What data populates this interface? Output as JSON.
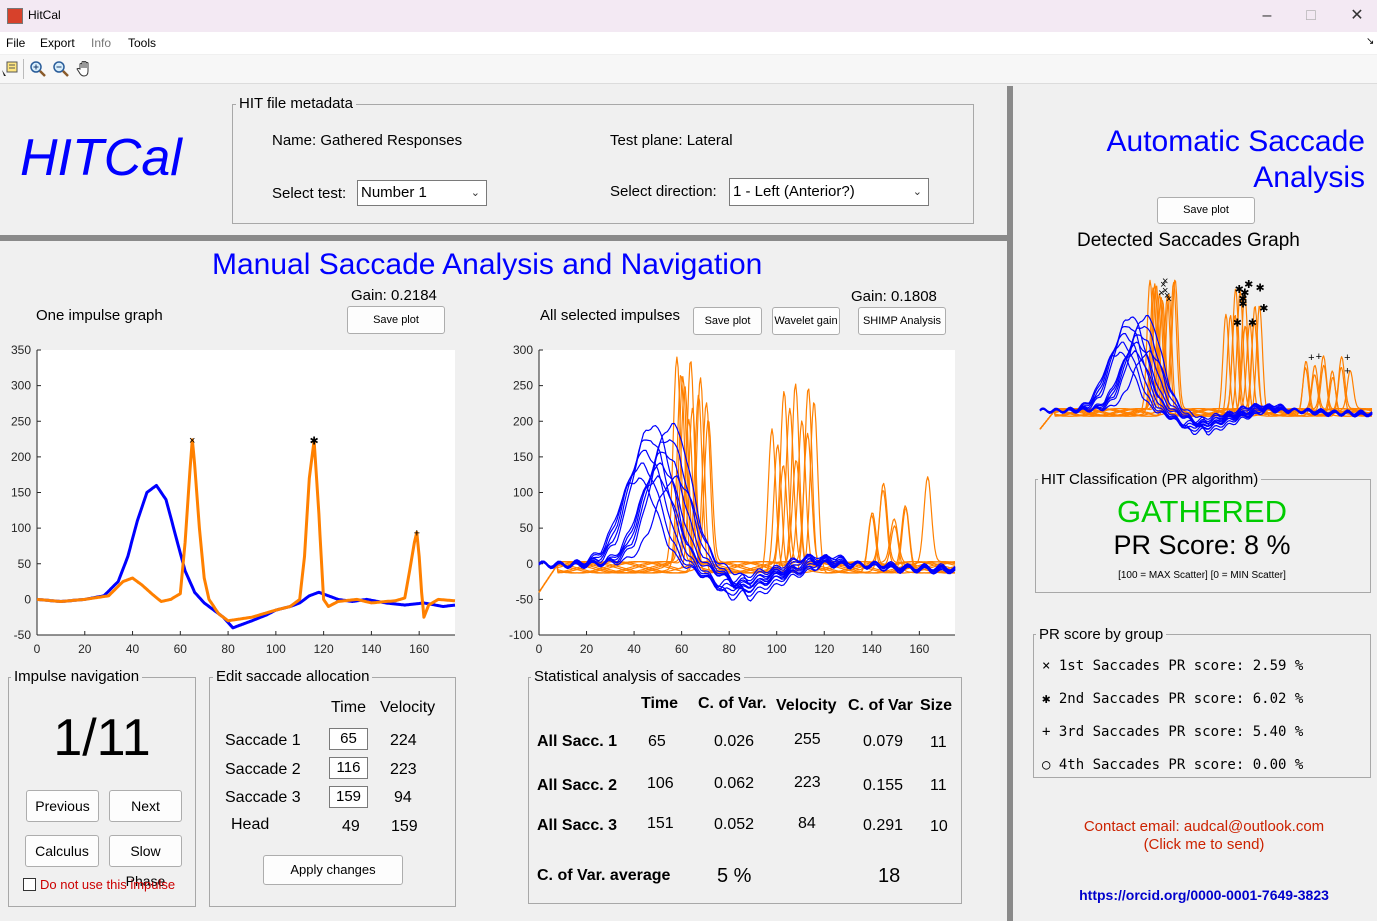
{
  "window": {
    "title": "HitCal",
    "minimize": "–",
    "maximize": "□",
    "close": "✕"
  },
  "menu": [
    "File",
    "Export",
    "Info",
    "Tools"
  ],
  "toolbar": {
    "icons": [
      "data-cursor-icon",
      "zoom-in-icon",
      "zoom-out-icon",
      "pan-hand-icon"
    ]
  },
  "logo": "HITCal",
  "metadata": {
    "legend": "HIT file metadata",
    "name": "Name: Gathered Responses",
    "plane": "Test plane: Lateral",
    "select_test_label": "Select test:",
    "select_test_value": "Number 1",
    "select_direction_label": "Select direction:",
    "select_direction_value": "1 - Left (Anterior?)"
  },
  "manual": {
    "title": "Manual Saccade Analysis and Navigation",
    "one_impulse": {
      "label": "One impulse graph",
      "gain": "Gain: 0.2184",
      "save": "Save plot"
    },
    "all_impulses": {
      "label": "All selected impulses",
      "gain": "Gain: 0.1808",
      "save": "Save plot",
      "wavelet": "Wavelet gain",
      "shimp": "SHIMP Analysis"
    }
  },
  "navigation": {
    "legend": "Impulse navigation",
    "counter": "1/11",
    "previous": "Previous",
    "next": "Next",
    "calculus": "Calculus",
    "slow_phase": "Slow Phase",
    "ignore_label": "Do not use this impulse"
  },
  "edit": {
    "legend": "Edit saccade allocation",
    "headers": [
      "Time",
      "Velocity"
    ],
    "rows": [
      {
        "label": "Saccade 1",
        "time": "65",
        "velocity": "224"
      },
      {
        "label": "Saccade 2",
        "time": "116",
        "velocity": "223"
      },
      {
        "label": "Saccade 3",
        "time": "159",
        "velocity": "94"
      }
    ],
    "head": {
      "label": "Head",
      "time": "49",
      "velocity": "159"
    },
    "apply": "Apply changes"
  },
  "stats": {
    "legend": "Statistical analysis of saccades",
    "headers": [
      "Time",
      "C. of Var.",
      "Velocity",
      "C. of Var",
      "Size"
    ],
    "rows": [
      {
        "label": "All Sacc. 1",
        "time": "65",
        "cv1": "0.026",
        "velocity": "255",
        "cv2": "0.079",
        "size": "11"
      },
      {
        "label": "All Sacc. 2",
        "time": "106",
        "cv1": "0.062",
        "velocity": "223",
        "cv2": "0.155",
        "size": "11"
      },
      {
        "label": "All Sacc. 3",
        "time": "151",
        "cv1": "0.052",
        "velocity": "84",
        "cv2": "0.291",
        "size": "10"
      }
    ],
    "avg_label": "C. of Var. average",
    "avg_time": "5 %",
    "avg_velocity": "18"
  },
  "automatic": {
    "title_line1": "Automatic Saccade",
    "title_line2": "Analysis",
    "save": "Save plot",
    "graph_title": "Detected Saccades Graph"
  },
  "classification": {
    "legend": "HIT Classification (PR algorithm)",
    "result": "GATHERED",
    "score": "PR Score: 8 %",
    "note": "[100 = MAX Scatter] [0 = MIN Scatter]",
    "result_color": "#00cc00"
  },
  "pr_groups": {
    "legend": "PR score by group",
    "items": [
      {
        "marker": "×",
        "text": "1st Saccades PR score: 2.59 %"
      },
      {
        "marker": "✱",
        "text": "2nd Saccades PR score: 6.02 %"
      },
      {
        "marker": "+",
        "text": "3rd Saccades PR score: 5.40 %"
      },
      {
        "marker": "○",
        "text": "4th Saccades PR score: 0.00 %"
      }
    ]
  },
  "contact": {
    "line1": "Contact email: audcal@outlook.com",
    "line2": "(Click me to send)",
    "orcid": "https://orcid.org/0000-0001-7649-3823"
  },
  "colors": {
    "head": "#0000ff",
    "eye": "#ff8000",
    "title_blue": "#0000ff",
    "contact_red": "#cc2200",
    "ignore_red": "#cc0000"
  },
  "chart_data": [
    {
      "type": "line",
      "title": "One impulse graph",
      "xlim": [
        0,
        175
      ],
      "ylim": [
        -50,
        350
      ],
      "xticks": [
        0,
        20,
        40,
        60,
        80,
        100,
        120,
        140,
        160
      ],
      "yticks": [
        -50,
        0,
        50,
        100,
        150,
        200,
        250,
        300,
        350
      ],
      "series": [
        {
          "role": "head",
          "x": [
            0,
            10,
            20,
            28,
            34,
            38,
            42,
            46,
            50,
            54,
            58,
            62,
            66,
            70,
            74,
            78,
            82,
            86,
            90,
            96,
            100,
            106,
            110,
            114,
            118,
            122,
            126,
            132,
            138,
            146,
            154,
            162,
            170,
            175
          ],
          "y": [
            0,
            -3,
            0,
            5,
            25,
            60,
            110,
            150,
            160,
            140,
            90,
            40,
            10,
            -5,
            -15,
            -25,
            -40,
            -35,
            -30,
            -22,
            -15,
            -10,
            -5,
            5,
            10,
            5,
            0,
            -3,
            0,
            -5,
            -8,
            -5,
            -10,
            -8
          ]
        },
        {
          "role": "eye",
          "x": [
            0,
            10,
            20,
            30,
            36,
            40,
            44,
            48,
            52,
            56,
            60,
            62,
            64,
            65,
            66,
            68,
            70,
            72,
            76,
            80,
            90,
            100,
            106,
            110,
            112,
            114,
            116,
            118,
            120,
            122,
            126,
            134,
            140,
            146,
            150,
            154,
            156,
            158,
            159,
            160,
            161,
            162,
            164,
            168,
            175
          ],
          "y": [
            0,
            -3,
            0,
            5,
            25,
            30,
            20,
            8,
            -3,
            0,
            8,
            80,
            180,
            224,
            190,
            100,
            30,
            0,
            -20,
            -30,
            -25,
            -15,
            -10,
            0,
            60,
            170,
            223,
            120,
            0,
            -10,
            -3,
            0,
            -5,
            -3,
            -2,
            2,
            40,
            80,
            94,
            60,
            10,
            -25,
            -8,
            0,
            -2
          ]
        }
      ],
      "markers": [
        {
          "x": 65,
          "y": 224,
          "symbol": "×"
        },
        {
          "x": 116,
          "y": 223,
          "symbol": "✱"
        },
        {
          "x": 159,
          "y": 94,
          "symbol": "+"
        }
      ]
    },
    {
      "type": "line",
      "title": "All selected impulses",
      "xlim": [
        0,
        175
      ],
      "ylim": [
        -100,
        300
      ],
      "xticks": [
        0,
        20,
        40,
        60,
        80,
        100,
        120,
        140,
        160
      ],
      "yticks": [
        -100,
        -50,
        0,
        50,
        100,
        150,
        200,
        250,
        300
      ],
      "series_count": {
        "head": 11,
        "eye": 11
      }
    },
    {
      "type": "line",
      "title": "Detected Saccades Graph",
      "series_count": {
        "head": 11,
        "eye": 11
      }
    }
  ]
}
